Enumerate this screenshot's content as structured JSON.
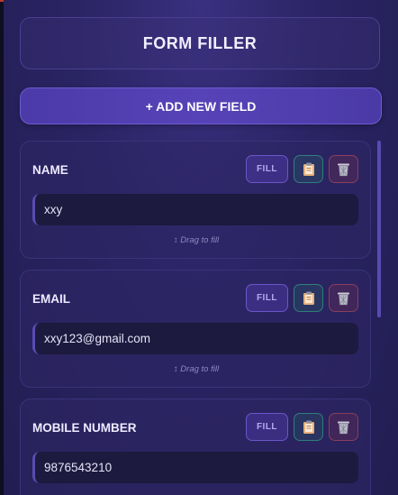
{
  "header": {
    "title": "FORM FILLER"
  },
  "toolbar": {
    "add_label": "+ ADD NEW FIELD"
  },
  "fields": [
    {
      "label": "NAME",
      "value": "xxy",
      "fill_label": "FILL",
      "drag_hint": "↕ Drag to fill"
    },
    {
      "label": "EMAIL",
      "value": "xxy123@gmail.com",
      "fill_label": "FILL",
      "drag_hint": "↕ Drag to fill"
    },
    {
      "label": "MOBILE NUMBER",
      "value": "9876543210",
      "fill_label": "FILL",
      "drag_hint": ""
    }
  ],
  "icons": {
    "copy": "clipboard-icon",
    "delete": "trash-icon"
  },
  "colors": {
    "accent": "#5743b8",
    "copy_border": "#2f7f7a",
    "delete_border": "#8a3f5e"
  }
}
